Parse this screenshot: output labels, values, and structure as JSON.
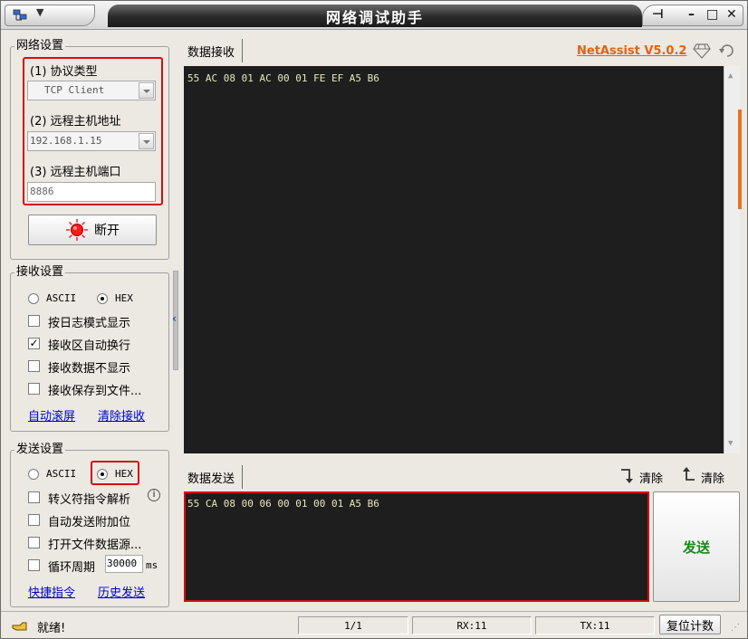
{
  "window": {
    "title": "网络调试助手"
  },
  "version_link": "NetAssist V5.0.2",
  "network_settings": {
    "title": "网络设置",
    "protocol_label": "(1) 协议类型",
    "protocol_value": "TCP Client",
    "host_label": "(2) 远程主机地址",
    "host_value": "192.168.1.15",
    "port_label": "(3) 远程主机端口",
    "port_value": "8886",
    "connect_button": "断开"
  },
  "receive_settings": {
    "title": "接收设置",
    "ascii_label": "ASCII",
    "hex_label": "HEX",
    "selected": "HEX",
    "options": [
      {
        "label": "按日志模式显示",
        "checked": false
      },
      {
        "label": "接收区自动换行",
        "checked": true
      },
      {
        "label": "接收数据不显示",
        "checked": false
      },
      {
        "label": "接收保存到文件...",
        "checked": false
      }
    ],
    "auto_scroll_link": "自动滚屏",
    "clear_receive_link": "清除接收"
  },
  "send_settings": {
    "title": "发送设置",
    "ascii_label": "ASCII",
    "hex_label": "HEX",
    "selected": "HEX",
    "options": [
      {
        "label": "转义符指令解析",
        "checked": false
      },
      {
        "label": "自动发送附加位",
        "checked": false
      },
      {
        "label": "打开文件数据源...",
        "checked": false
      },
      {
        "label": "循环周期",
        "checked": false
      }
    ],
    "period_value": "30000",
    "period_unit": "ms",
    "shortcut_link": "快捷指令",
    "history_link": "历史发送"
  },
  "receive_area": {
    "tab_label": "数据接收",
    "content": "55 AC 08 01 AC 00 01 FE EF A5 B6"
  },
  "send_area": {
    "tab_label": "数据发送",
    "clear_label_1": "清除",
    "clear_label_2": "清除",
    "content": "55 CA 08 00 06 00 01 00 01 A5 B6",
    "send_button": "发送"
  },
  "status_bar": {
    "status": "就绪!",
    "page": "1/1",
    "rx": "RX:11",
    "tx": "TX:11",
    "reset_button": "复位计数"
  },
  "colors": {
    "highlight_red": "#d01010",
    "link_orange": "#e8600a",
    "send_green": "#1a8a1a",
    "terminal_bg": "#1e1e1e"
  }
}
